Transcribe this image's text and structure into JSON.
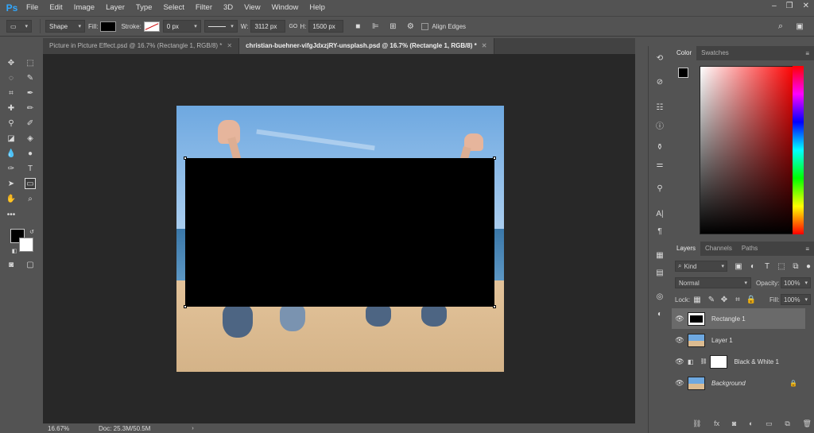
{
  "menubar": {
    "logo": "Ps",
    "items": [
      "File",
      "Edit",
      "Image",
      "Layer",
      "Type",
      "Select",
      "Filter",
      "3D",
      "View",
      "Window",
      "Help"
    ]
  },
  "options": {
    "mode": "Shape",
    "fill_label": "Fill:",
    "stroke_label": "Stroke:",
    "stroke_width": "0 px",
    "w_label": "W:",
    "w_value": "3112 px",
    "link_glyph": "GO",
    "h_label": "H:",
    "h_value": "1500 px",
    "align_edges": "Align Edges"
  },
  "tabs": [
    {
      "title": "Picture in Picture Effect.psd @ 16.7% (Rectangle 1, RGB/8) *"
    },
    {
      "title": "christian-buehner-vifgJdxzjRY-unsplash.psd @ 16.7% (Rectangle 1, RGB/8) *"
    }
  ],
  "status": {
    "zoom": "16.67%",
    "doc": "Doc: 25.3M/50.5M"
  },
  "color_panel": {
    "tabs": [
      "Color",
      "Swatches"
    ]
  },
  "layers_panel": {
    "tabs": [
      "Layers",
      "Channels",
      "Paths"
    ],
    "filter": "Kind",
    "blend_mode": "Normal",
    "opacity_label": "Opacity:",
    "opacity": "100%",
    "lock_label": "Lock:",
    "fill_label": "Fill:",
    "fill": "100%",
    "layers": [
      {
        "name": "Rectangle 1"
      },
      {
        "name": "Layer 1"
      },
      {
        "name": "Black & White 1"
      },
      {
        "name": "Background"
      }
    ]
  },
  "colors": {
    "ui_bg": "#535353",
    "canvas_bg": "#282828",
    "accent": "#31a8ff"
  }
}
